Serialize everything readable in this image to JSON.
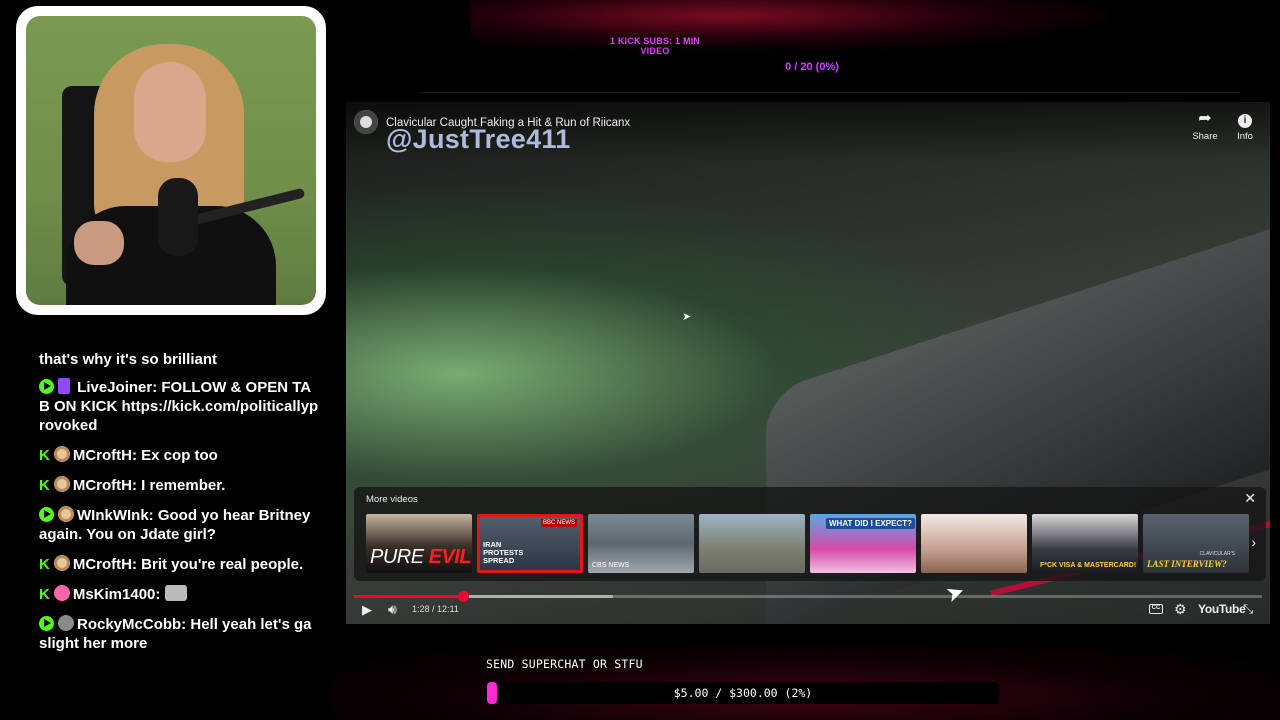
{
  "top_goal": {
    "label": "1 KICK SUBS: 1 MIN VIDEO",
    "progress_text": "0 / 20 (0%)"
  },
  "webcam": {
    "description": "streamer-camera"
  },
  "chat": {
    "messages": [
      {
        "platform": "",
        "user": "",
        "text": "that's why it's so brilliant"
      },
      {
        "platform": "youtube",
        "badge": "twitch",
        "user": "LiveJoiner:",
        "text": "FOLLOW & OPEN TAB ON KICK https://kick.com/politicallyprovoked"
      },
      {
        "platform": "kick",
        "badge": "cookie",
        "user": "MCroftH:",
        "text": "Ex cop too"
      },
      {
        "platform": "kick",
        "badge": "cookie",
        "user": "MCroftH:",
        "text": "I remember."
      },
      {
        "platform": "youtube",
        "badge": "avatar",
        "user": "WInkWInk:",
        "text": "Good yo hear Britney again. You on Jdate girl?"
      },
      {
        "platform": "kick",
        "badge": "cookie",
        "user": "MCroftH:",
        "text": "Brit you're real people."
      },
      {
        "platform": "kick",
        "badge": "pink",
        "user": "MsKim1400:",
        "text": ""
      },
      {
        "platform": "youtube",
        "badge": "alien",
        "user": "RockyMcCobb:",
        "text": "Hell yeah let's gaslight her more"
      }
    ]
  },
  "player": {
    "title": "Clavicular Caught Faking a Hit & Run of Riicanx",
    "watermark": "@JustTree411",
    "share_label": "Share",
    "info_label": "Info",
    "more_videos": {
      "title": "More videos",
      "thumbnails": [
        {
          "text_a": "PURE ",
          "text_b": "EVIL"
        },
        {
          "text": "IRAN PROTESTS SPREAD",
          "tag": "BBC NEWS"
        },
        {
          "text": "CBS NEWS"
        },
        {
          "text": ""
        },
        {
          "text": "WHAT DID I EXPECT?"
        },
        {
          "text": ""
        },
        {
          "text": "F*CK VISA & MASTERCARD!"
        },
        {
          "text": "LAST INTERVIEW?",
          "overline": "CLAVICULAR'S"
        }
      ]
    },
    "time": "1:28 / 12:11",
    "progress_fraction": 0.12,
    "buffer_fraction": 0.285,
    "youtube_logo": "YouTube",
    "cc_label": "CC"
  },
  "superchat": {
    "label": "SEND SUPERCHAT OR STFU",
    "progress_text": "$5.00 / $300.00 (2%)",
    "progress_fraction": 0.02
  }
}
